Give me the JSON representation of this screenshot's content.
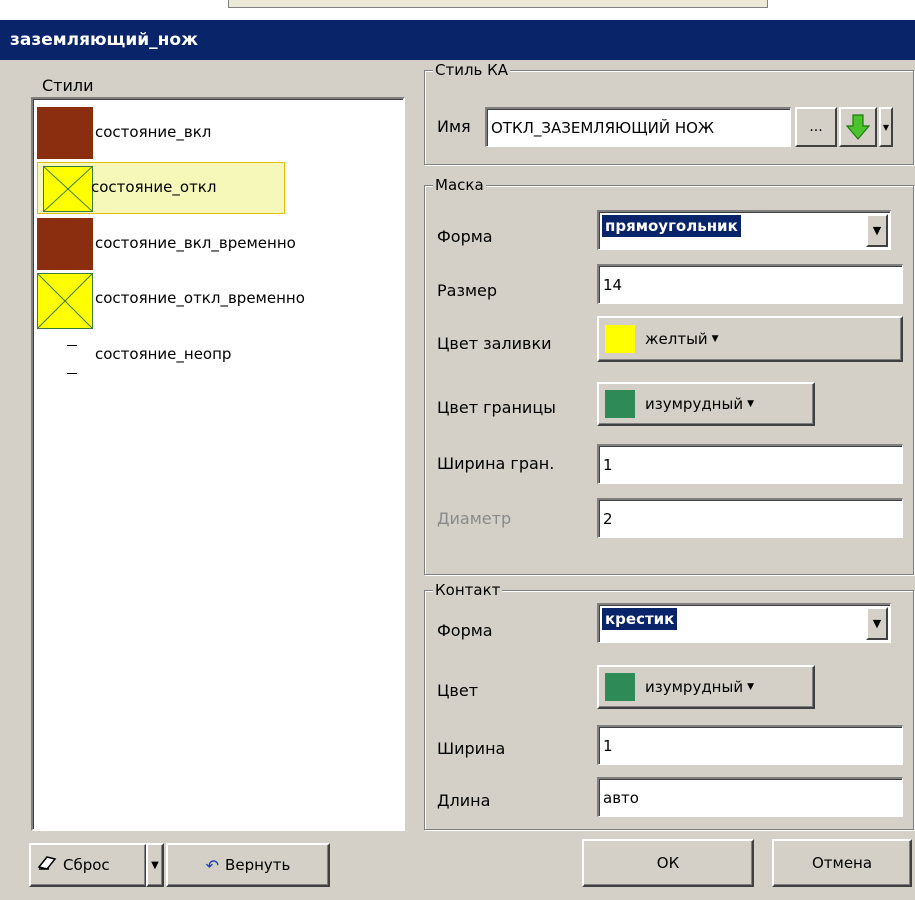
{
  "window": {
    "title": "заземляющий_нож"
  },
  "styles": {
    "label": "Стили",
    "items": [
      {
        "label": "состояние_вкл",
        "swatch": "brown",
        "selected": false
      },
      {
        "label": "состояние_откл",
        "swatch": "yellow-cross",
        "selected": true
      },
      {
        "label": "состояние_вкл_временно",
        "swatch": "brown",
        "selected": false
      },
      {
        "label": "состояние_откл_временно",
        "swatch": "yellow-cross",
        "selected": false
      },
      {
        "label": "состояние_неопр",
        "swatch": "dashes",
        "selected": false
      }
    ]
  },
  "style_ka": {
    "title": "Стиль КА",
    "name_label": "Имя",
    "name_value": "ОТКЛ_ЗАЗЕМЛЯЮЩИЙ НОЖ",
    "browse_label": "...",
    "arrow_icon": "green-down-arrow-icon"
  },
  "mask": {
    "title": "Маска",
    "shape_label": "Форма",
    "shape_value": "прямоугольник",
    "size_label": "Размер",
    "size_value": "14",
    "fill_label": "Цвет заливки",
    "fill_value": "желтый",
    "fill_color": "#ffff00",
    "border_label": "Цвет границы",
    "border_value": "изумрудный",
    "border_color": "#2e8b57",
    "border_width_label": "Ширина гран.",
    "border_width_value": "1",
    "diameter_label": "Диаметр",
    "diameter_value": "2"
  },
  "contact": {
    "title": "Контакт",
    "shape_label": "Форма",
    "shape_value": "крестик",
    "color_label": "Цвет",
    "color_value": "изумрудный",
    "color_hex": "#2e8b57",
    "width_label": "Ширина",
    "width_value": "1",
    "length_label": "Длина",
    "length_value": "авто"
  },
  "buttons": {
    "reset": "Сброс",
    "revert": "Вернуть",
    "ok": "ОК",
    "cancel": "Отмена"
  },
  "colors": {
    "titlebar": "#0a246a",
    "brown": "#8b2e10",
    "yellow": "#ffff00",
    "selection_bg": "#f5f8b8"
  }
}
